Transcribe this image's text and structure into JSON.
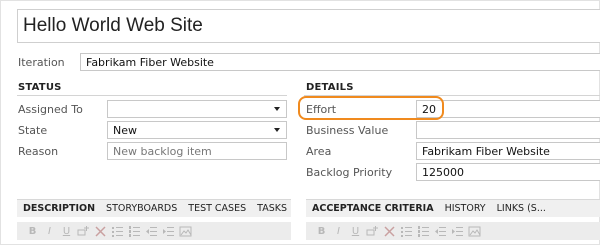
{
  "title": "Hello World Web Site",
  "iteration": {
    "label": "Iteration",
    "value": "Fabrikam Fiber Website"
  },
  "status": {
    "heading": "STATUS",
    "assigned_to": {
      "label": "Assigned To",
      "value": ""
    },
    "state": {
      "label": "State",
      "value": "New"
    },
    "reason": {
      "label": "Reason",
      "placeholder": "New backlog item"
    }
  },
  "details": {
    "heading": "DETAILS",
    "effort": {
      "label": "Effort",
      "value": "20"
    },
    "business_value": {
      "label": "Business Value",
      "value": ""
    },
    "area": {
      "label": "Area",
      "value": "Fabrikam Fiber Website"
    },
    "backlog_priority": {
      "label": "Backlog Priority",
      "value": "125000"
    }
  },
  "left_tabs": [
    "DESCRIPTION",
    "STORYBOARDS",
    "TEST CASES",
    "TASKS"
  ],
  "right_tabs": [
    "ACCEPTANCE CRITERIA",
    "HISTORY",
    "LINKS (S..."
  ],
  "toolbar_glyphs": {
    "bold": "B",
    "italic": "I",
    "underline": "U"
  },
  "colors": {
    "highlight": "#f08a1e",
    "border": "#c8c8c8",
    "muted_icon": "#b8b8b8"
  }
}
